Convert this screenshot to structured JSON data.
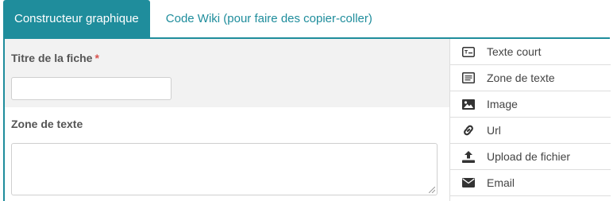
{
  "tabs": {
    "active_label": "Constructeur graphique",
    "inactive_label": "Code Wiki (pour faire des copier-coller)"
  },
  "form": {
    "title_field": {
      "label": "Titre de la fiche",
      "required_mark": "*",
      "value": ""
    },
    "zone_field": {
      "label": "Zone de texte",
      "value": ""
    }
  },
  "components": [
    {
      "label": "Texte court",
      "icon": "text-input-icon"
    },
    {
      "label": "Zone de texte",
      "icon": "textarea-icon"
    },
    {
      "label": "Image",
      "icon": "image-icon"
    },
    {
      "label": "Url",
      "icon": "link-icon"
    },
    {
      "label": "Upload de fichier",
      "icon": "upload-icon"
    },
    {
      "label": "Email",
      "icon": "email-icon"
    }
  ],
  "colors": {
    "accent": "#1f8d9c",
    "required": "#d9534f",
    "panel_grey": "#f2f2f2"
  }
}
